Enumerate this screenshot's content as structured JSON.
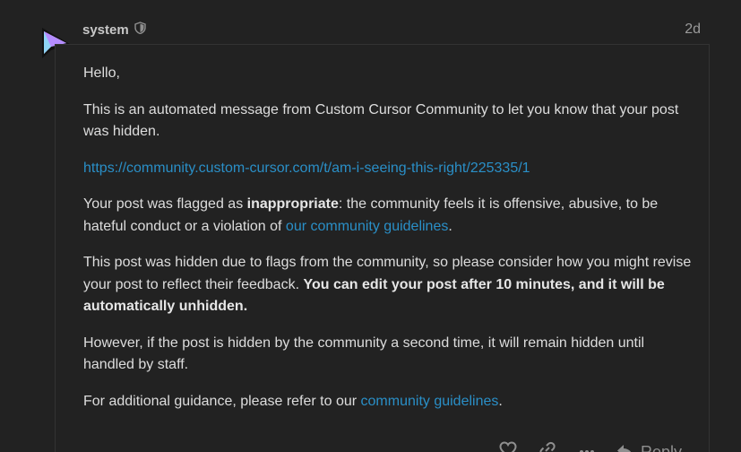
{
  "post": {
    "username": "system",
    "date": "2d",
    "greeting": "Hello,",
    "intro": "This is an automated message from Custom Cursor Community to let you know that your post was hidden.",
    "link": "https://community.custom-cursor.com/t/am-i-seeing-this-right/225335/1",
    "flagged_prefix": "Your post was flagged as ",
    "flagged_reason": "inappropriate",
    "flagged_mid": ": the community feels it is offensive, abusive, to be hateful conduct or a violation of ",
    "flagged_link": "our community guidelines",
    "flagged_end": ".",
    "hidden_text": "This post was hidden due to flags from the community, so please consider how you might revise your post to reflect their feedback. ",
    "hidden_bold": "You can edit your post after 10 minutes, and it will be automatically unhidden.",
    "second_time": "However, if the post is hidden by the community a second time, it will remain hidden until handled by staff.",
    "guidance_prefix": "For additional guidance, please refer to our ",
    "guidance_link": "community guidelines",
    "guidance_end": "."
  },
  "actions": {
    "reply_label": "Reply"
  },
  "icons": {
    "avatar": "cursor-arrow-avatar",
    "shield": "shield-icon",
    "like": "heart-icon",
    "link": "link-icon",
    "more": "ellipsis-icon",
    "reply": "reply-arrow-icon"
  },
  "colors": {
    "background": "#222222",
    "text": "#dddddd",
    "link": "#2a8fc7",
    "muted": "#9a9a9a"
  }
}
